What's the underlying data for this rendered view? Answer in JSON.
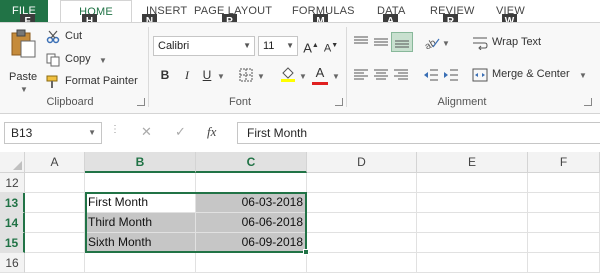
{
  "tabs": {
    "file": "FILE",
    "home": "HOME",
    "insert": "INSERT",
    "page_layout": "PAGE LAYOUT",
    "formulas": "FORMULAS",
    "data": "DATA",
    "review": "REVIEW",
    "view": "VIEW"
  },
  "keytips": {
    "file": "F",
    "home": "H",
    "insert": "N",
    "page_layout": "P",
    "formulas": "M",
    "data": "A",
    "review": "R",
    "view": "W"
  },
  "clipboard": {
    "paste": "Paste",
    "cut": "Cut",
    "copy": "Copy",
    "format_painter": "Format Painter",
    "label": "Clipboard"
  },
  "font": {
    "name": "Calibri",
    "size": "11",
    "bold": "B",
    "italic": "I",
    "underline": "U",
    "label": "Font"
  },
  "alignment": {
    "wrap_text": "Wrap Text",
    "merge_center": "Merge & Center",
    "label": "Alignment"
  },
  "formula_bar": {
    "name_box": "B13",
    "fx": "fx",
    "value": "First Month"
  },
  "grid": {
    "columns": [
      "A",
      "B",
      "C",
      "D",
      "E",
      "F"
    ],
    "rows": [
      "12",
      "13",
      "14",
      "15",
      "16"
    ],
    "cells": {
      "B13": "First Month",
      "C13": "06-03-2018",
      "B14": "Third Month",
      "C14": "06-06-2018",
      "B15": "Sixth Month",
      "C15": "06-09-2018"
    }
  },
  "colors": {
    "accent": "#217346",
    "selection_fill": "#c6c6c6"
  }
}
